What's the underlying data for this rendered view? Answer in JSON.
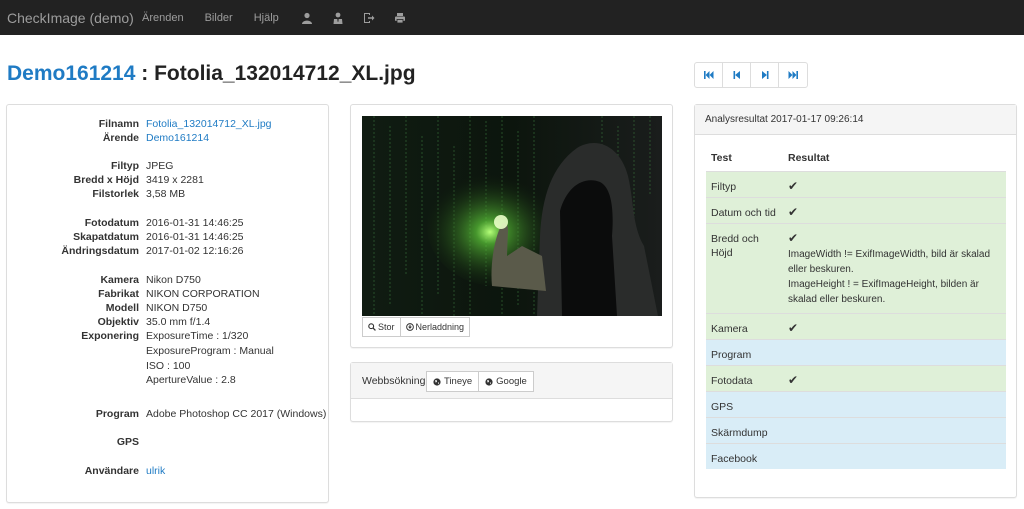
{
  "navbar": {
    "brand": "CheckImage (demo)",
    "links": [
      "Ärenden",
      "Bilder",
      "Hjälp"
    ],
    "icons": [
      "user-icon",
      "user-tie-icon",
      "logout-icon",
      "print-icon"
    ]
  },
  "title": {
    "case": "Demo161214",
    "separator": " : ",
    "filename": "Fotolia_132014712_XL.jpg"
  },
  "pager": {
    "icons": [
      "first-icon",
      "previous-icon",
      "next-icon",
      "last-icon"
    ]
  },
  "info": [
    {
      "key": "Filnamn",
      "value": "Fotolia_132014712_XL.jpg",
      "link": true
    },
    {
      "key": "Ärende",
      "value": "Demo161214",
      "link": true
    },
    {
      "key": "Filtyp",
      "value": "JPEG"
    },
    {
      "key": "Bredd x Höjd",
      "value": "3419 x 2281"
    },
    {
      "key": "Filstorlek",
      "value": "3,58 MB"
    },
    {
      "key": "Fotodatum",
      "value": "2016-01-31 14:46:25"
    },
    {
      "key": "Skapatdatum",
      "value": "2016-01-31 14:46:25"
    },
    {
      "key": "Ändringsdatum",
      "value": "2017-01-02 12:16:26"
    },
    {
      "key": "Kamera",
      "value": "Nikon D750"
    },
    {
      "key": "Fabrikat",
      "value": "NIKON CORPORATION"
    },
    {
      "key": "Modell",
      "value": "NIKON D750"
    },
    {
      "key": "Objektiv",
      "value": "35.0 mm f/1.4"
    },
    {
      "key": "Exponering",
      "value": "ExposureTime : 1/320"
    },
    {
      "key": "",
      "value": "ExposureProgram : Manual"
    },
    {
      "key": "",
      "value": "ISO : 100"
    },
    {
      "key": "",
      "value": "ApertureValue : 2.8"
    },
    {
      "key": "Program",
      "value": "Adobe Photoshop CC 2017 (Windows)"
    },
    {
      "key": "GPS",
      "value": ""
    },
    {
      "key": "Användare",
      "value": "ulrik",
      "link": true
    }
  ],
  "image_buttons": {
    "large": "Stor",
    "download": "Nerladdning"
  },
  "web_search": {
    "label": "Webbsökning",
    "tineye": "Tineye",
    "google": "Google"
  },
  "analysis": {
    "title": "Analysresultat 2017-01-17 09:26:14",
    "col_test": "Test",
    "col_result": "Resultat",
    "check": "✔",
    "rows": [
      {
        "test": "Filtyp",
        "status": "ok",
        "ok": true,
        "result": ""
      },
      {
        "test": "Datum och tid",
        "status": "ok",
        "ok": true,
        "result": ""
      },
      {
        "test": "Bredd och Höjd",
        "status": "ok",
        "ok": true,
        "result": "ImageWidth != ExifImageWidth, bild är skalad eller beskuren.\nImageHeight ! = ExifImageHeight, bilden är skalad eller beskuren."
      },
      {
        "test": "Kamera",
        "status": "ok",
        "ok": true,
        "result": ""
      },
      {
        "test": "Program",
        "status": "info",
        "ok": false,
        "result": ""
      },
      {
        "test": "Fotodata",
        "status": "ok",
        "ok": true,
        "result": ""
      },
      {
        "test": "GPS",
        "status": "info",
        "ok": false,
        "result": ""
      },
      {
        "test": "Skärmdump",
        "status": "info",
        "ok": false,
        "result": ""
      },
      {
        "test": "Facebook",
        "status": "info",
        "ok": false,
        "result": ""
      }
    ]
  },
  "colors": {
    "navbar": "#222222",
    "link": "#1f7bc4",
    "ok_row": "#dff0d8",
    "info_row": "#d9edf7"
  }
}
